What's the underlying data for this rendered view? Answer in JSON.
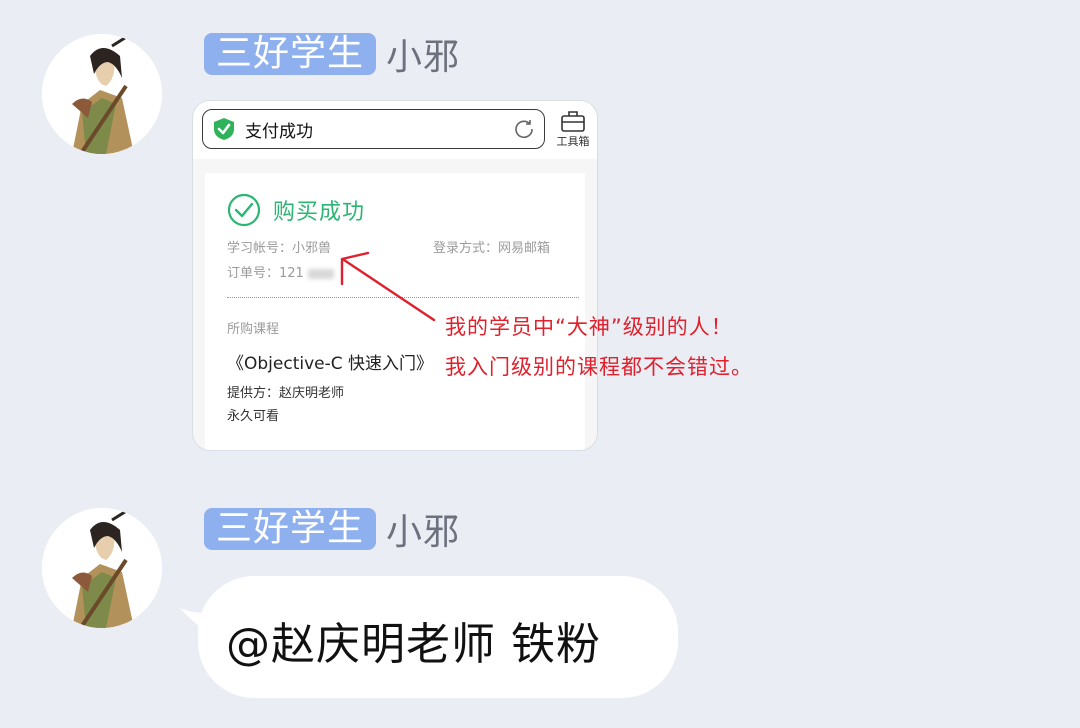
{
  "messages": [
    {
      "sender_badge": "三好学生",
      "sender_name": "小邪",
      "avatar": "ink-painting-swordsman-avatar",
      "type": "image",
      "screenshot": {
        "address_bar_text": "支付成功",
        "toolbox_label": "工具箱",
        "status_title": "购买成功",
        "account_label": "学习帐号：小邪兽",
        "login_label": "登录方式：网易邮箱",
        "order_label": "订单号：121",
        "purchased_label": "所购课程",
        "course_title": "《Objective-C 快速入门》",
        "provider": "提供方：赵庆明老师",
        "validity": "永久可看"
      },
      "annotation_lines": [
        "我的学员中“大神”级别的人！",
        "我入门级别的课程都不会错过。"
      ]
    },
    {
      "sender_badge": "三好学生",
      "sender_name": "小邪",
      "avatar": "ink-painting-swordsman-avatar",
      "type": "text",
      "text": "@赵庆明老师 铁粉"
    }
  ],
  "colors": {
    "background": "#eaedf4",
    "badge": "#8fb0ee",
    "success_green": "#2bb673",
    "annotation_red": "#e0202c"
  }
}
